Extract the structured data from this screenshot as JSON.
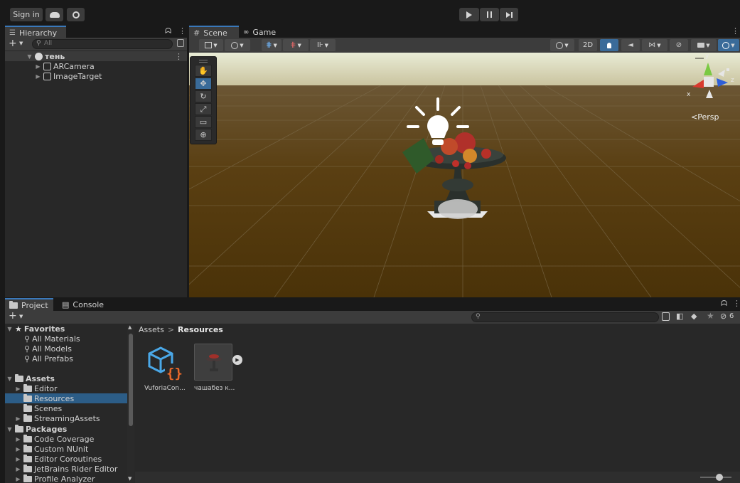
{
  "topbar": {
    "sign_in": "Sign in",
    "cloud_icon": "cloud-icon",
    "collab_icon": "collab-icon",
    "play_icon": "play-icon",
    "pause_icon": "pause-icon",
    "step_icon": "step-icon"
  },
  "hierarchy": {
    "tab_label": "Hierarchy",
    "search_placeholder": "All",
    "scene_name": "тень",
    "items": [
      {
        "label": "ARCamera"
      },
      {
        "label": "ImageTarget"
      }
    ]
  },
  "scene_view": {
    "tabs": [
      {
        "label": "Scene"
      },
      {
        "label": "Game"
      }
    ],
    "mode_2d": "2D",
    "persp_label": "<Persp",
    "gizmo_axes": {
      "x": "x",
      "y": "y",
      "z": "z"
    },
    "tools": [
      "hand-tool",
      "move-tool",
      "rotate-tool",
      "scale-tool",
      "rect-tool",
      "transform-tool"
    ]
  },
  "project": {
    "tabs": [
      {
        "label": "Project"
      },
      {
        "label": "Console"
      }
    ],
    "hidden_count": "6",
    "breadcrumb": {
      "root": "Assets",
      "separator": ">",
      "current": "Resources"
    },
    "favorites": {
      "label": "Favorites",
      "items": [
        "All Materials",
        "All Models",
        "All Prefabs"
      ]
    },
    "assets": {
      "label": "Assets",
      "items": [
        "Editor",
        "Resources",
        "Scenes",
        "StreamingAssets"
      ]
    },
    "packages": {
      "label": "Packages",
      "items": [
        "Code Coverage",
        "Custom NUnit",
        "Editor Coroutines",
        "JetBrains Rider Editor",
        "Profile Analyzer"
      ]
    },
    "files": [
      {
        "label": "VuforiaCon..."
      },
      {
        "label": "чашабез к..."
      }
    ]
  },
  "colors": {
    "accent": "#3a79bb",
    "selection": "#2c5d87",
    "sky_top": "#e9ecd6",
    "ground": "#5a3f12"
  }
}
